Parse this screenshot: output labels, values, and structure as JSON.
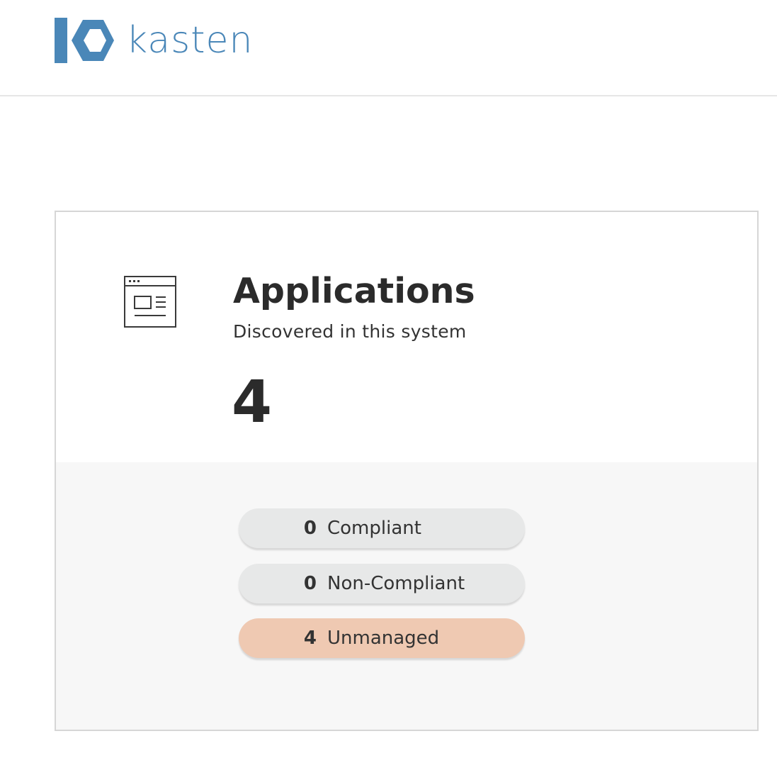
{
  "header": {
    "brand_name": "kasten",
    "logo_icon": "kasten-logo-icon",
    "brand_color": "#4a87b8"
  },
  "card": {
    "icon": "application-window-icon",
    "title": "Applications",
    "subtitle": "Discovered in this system",
    "count": "4",
    "statuses": [
      {
        "count": "0",
        "label": "Compliant",
        "color": "#e7e8e8"
      },
      {
        "count": "0",
        "label": "Non-Compliant",
        "color": "#e7e8e8"
      },
      {
        "count": "4",
        "label": "Unmanaged",
        "color": "#efc9b2"
      }
    ]
  }
}
